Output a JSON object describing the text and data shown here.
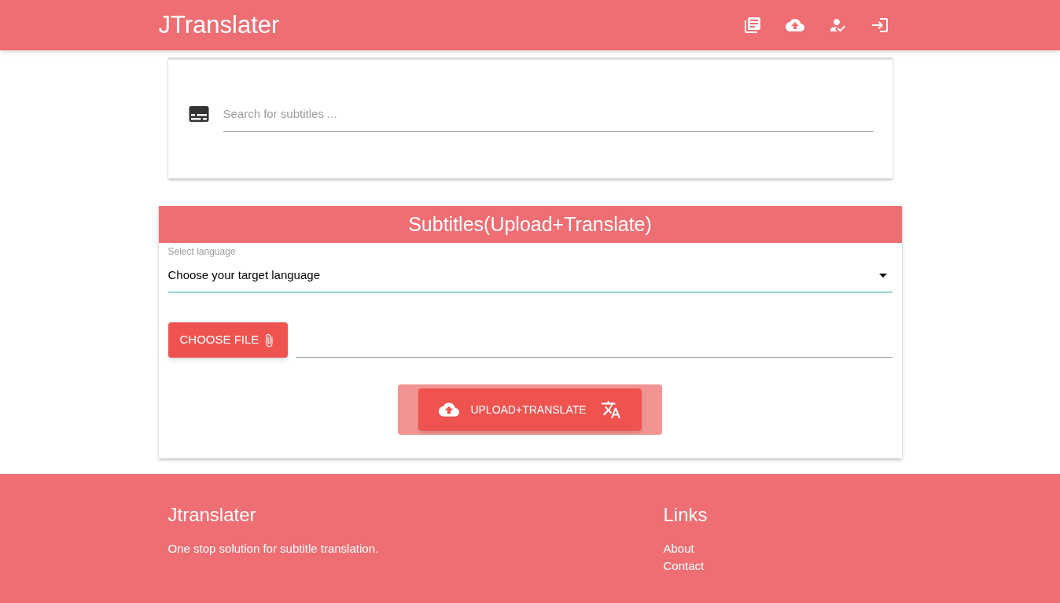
{
  "header": {
    "title": "JTranslater"
  },
  "search": {
    "placeholder": "Search for subtitles ..."
  },
  "upload_card": {
    "title": "Subtitles(Upload+Translate)",
    "language_label": "Select language",
    "language_value": "Choose your target language",
    "choose_file_button": "CHOOSE FILE",
    "submit_button": "UPLOAD+TRANSLATE"
  },
  "footer": {
    "brand": "Jtranslater",
    "tagline": "One stop solution for subtitle translation.",
    "links_title": "Links",
    "links": [
      "About",
      "Contact"
    ]
  }
}
